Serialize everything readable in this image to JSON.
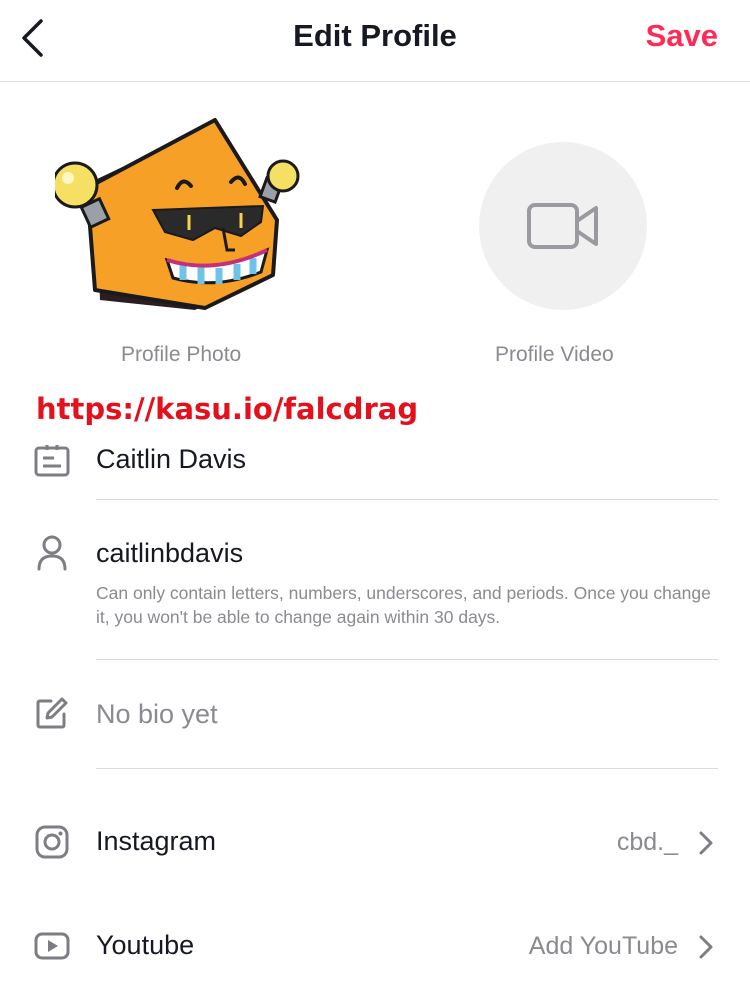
{
  "header": {
    "title": "Edit Profile",
    "save_label": "Save"
  },
  "media": {
    "photo_label": "Profile Photo",
    "video_label": "Profile Video"
  },
  "promo_link": "https://kasu.io/falcdrag",
  "profile": {
    "name": "Caitlin Davis",
    "username": "caitlinbdavis",
    "username_hint": "Can only contain letters, numbers, underscores, and periods. Once you change it, you won't be able to change again within 30 days.",
    "bio_placeholder": "No bio yet"
  },
  "links": [
    {
      "label": "Instagram",
      "value": "cbd._",
      "icon": "instagram-icon"
    },
    {
      "label": "Youtube",
      "value": "Add YouTube",
      "icon": "youtube-icon"
    }
  ],
  "colors": {
    "accent": "#fe2c55",
    "promo": "#e3111d",
    "secondary_text": "#8a8b91",
    "divider": "#dcdcdc"
  }
}
